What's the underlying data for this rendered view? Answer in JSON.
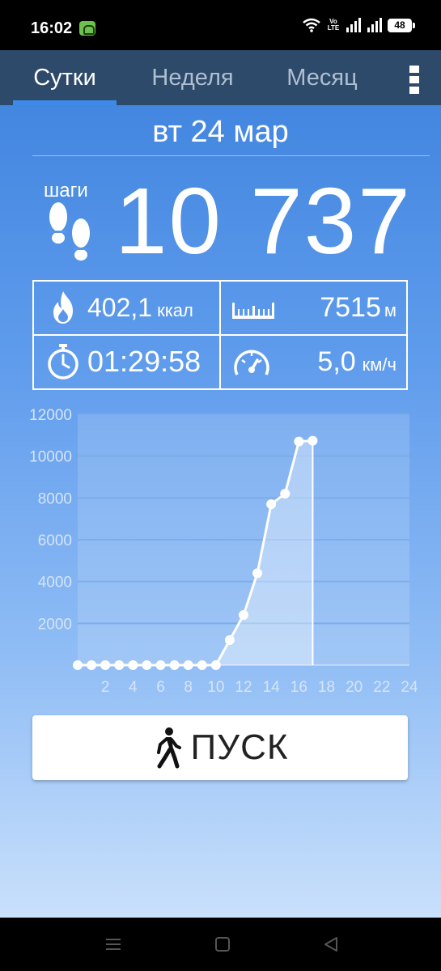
{
  "status_bar": {
    "time": "16:02",
    "network_label": "Vo LTE",
    "battery": "48",
    "icons": [
      "app-notification-icon",
      "wifi-icon",
      "signal-icon",
      "battery-icon"
    ]
  },
  "tabs": [
    {
      "label": "Сутки",
      "active": true
    },
    {
      "label": "Неделя",
      "active": false
    },
    {
      "label": "Месяц",
      "active": false
    }
  ],
  "date": "вт 24 мар",
  "steps": {
    "label": "шаги",
    "value": "10 737"
  },
  "stats": {
    "calories": {
      "value": "402,1",
      "unit": "ккал",
      "icon": "flame-icon"
    },
    "distance": {
      "value": "7515",
      "unit": "м",
      "icon": "ruler-icon"
    },
    "duration": {
      "value": "01:29:58",
      "icon": "stopwatch-icon"
    },
    "speed": {
      "value": "5,0",
      "unit": "км/ч",
      "icon": "speedometer-icon"
    }
  },
  "start_button": {
    "label": "ПУСК",
    "icon": "walking-person-icon"
  },
  "colors": {
    "tabbar": "#2d4a6a",
    "accent": "#3d8ae8",
    "chart_line": "#ffffff"
  },
  "chart_data": {
    "type": "area",
    "x": [
      0,
      1,
      2,
      3,
      4,
      5,
      6,
      7,
      8,
      9,
      10,
      11,
      12,
      13,
      14,
      15,
      16,
      17
    ],
    "y": [
      0,
      0,
      0,
      0,
      0,
      0,
      0,
      0,
      0,
      0,
      0,
      1200,
      2400,
      4400,
      7700,
      8200,
      10700,
      10737
    ],
    "x_ticks": [
      "2",
      "4",
      "6",
      "8",
      "10",
      "12",
      "14",
      "16",
      "18",
      "20",
      "22",
      "24"
    ],
    "y_ticks": [
      "2000",
      "4000",
      "6000",
      "8000",
      "10000",
      "12000"
    ],
    "xlim": [
      0,
      24
    ],
    "ylim": [
      0,
      12000
    ],
    "grid": true
  }
}
